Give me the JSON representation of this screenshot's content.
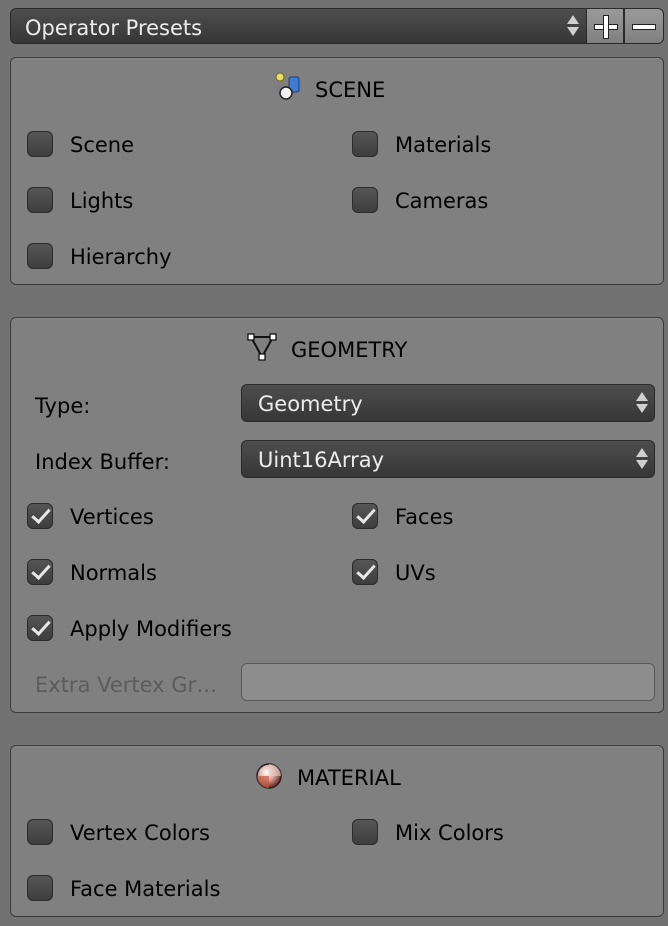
{
  "presets": {
    "label": "Operator Presets",
    "add_icon": "plus-icon",
    "remove_icon": "minus-icon"
  },
  "scene": {
    "title": "SCENE",
    "icon": "scene-icon",
    "options": [
      {
        "label": "Scene",
        "checked": false
      },
      {
        "label": "Materials",
        "checked": false
      },
      {
        "label": "Lights",
        "checked": false
      },
      {
        "label": "Cameras",
        "checked": false
      },
      {
        "label": "Hierarchy",
        "checked": false
      }
    ]
  },
  "geometry": {
    "title": "GEOMETRY",
    "icon": "mesh-triangle-icon",
    "type_label": "Type:",
    "type_value": "Geometry",
    "index_buffer_label": "Index Buffer:",
    "index_buffer_value": "Uint16Array",
    "options": [
      {
        "label": "Vertices",
        "checked": true
      },
      {
        "label": "Faces",
        "checked": true
      },
      {
        "label": "Normals",
        "checked": true
      },
      {
        "label": "UVs",
        "checked": true
      },
      {
        "label": "Apply Modifiers",
        "checked": true
      }
    ],
    "extra_vertex_label": "Extra Vertex Gr…",
    "extra_vertex_value": ""
  },
  "material": {
    "title": "MATERIAL",
    "icon": "material-sphere-icon",
    "options": [
      {
        "label": "Vertex Colors",
        "checked": false
      },
      {
        "label": "Mix Colors",
        "checked": false
      },
      {
        "label": "Face Materials",
        "checked": false
      }
    ]
  },
  "colors": {
    "background": "#727272",
    "panel": "#808080",
    "dropdown": "#3e3e3e",
    "check_mark": "#e6e6e6"
  }
}
